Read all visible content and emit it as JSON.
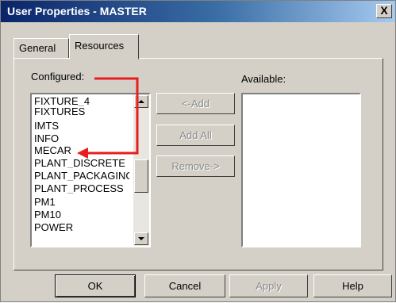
{
  "window": {
    "title": "User Properties - MASTER",
    "close_label": "X"
  },
  "tabs": [
    {
      "label": "General"
    },
    {
      "label": "Resources"
    }
  ],
  "configured": {
    "label": "Configured:",
    "items": [
      "FIXTURE_4",
      "FIXTURES",
      "IMTS",
      "INFO",
      "MECAR",
      "PLANT_DISCRETE",
      "PLANT_PACKAGING",
      "PLANT_PROCESS",
      "PM1",
      "PM10",
      "POWER"
    ]
  },
  "available": {
    "label": "Available:",
    "items": []
  },
  "middle_buttons": {
    "add": "<-Add",
    "add_all": "Add All",
    "remove": "Remove->"
  },
  "footer": {
    "ok": "OK",
    "cancel": "Cancel",
    "apply": "Apply",
    "help": "Help"
  },
  "colors": {
    "annotation_arrow": "#e81e1e",
    "title_gradient_start": "#0a246a",
    "title_gradient_end": "#a6caf0"
  }
}
